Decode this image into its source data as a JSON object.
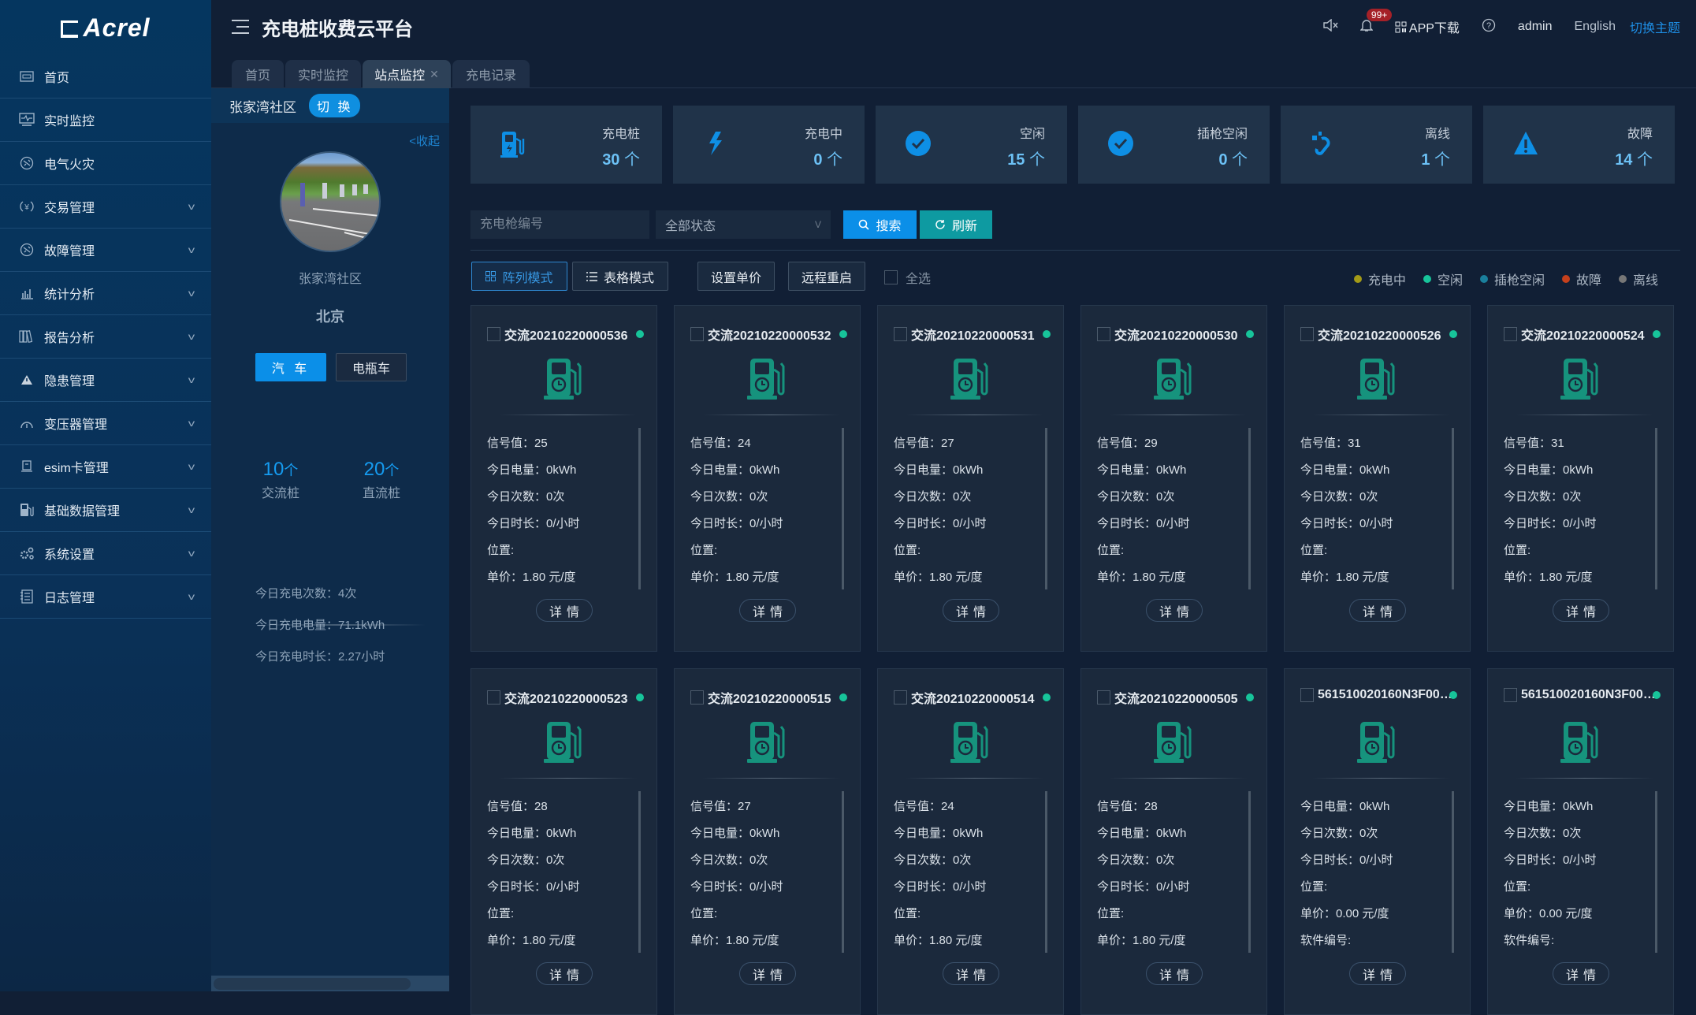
{
  "app": {
    "logo": "Acrel",
    "title": "充电桩收费云平台"
  },
  "topbar": {
    "mute_icon": "speaker-mute-icon",
    "notif_badge": "99+",
    "app_download": "APP下载",
    "help_icon": "question-circle-icon",
    "user": "admin",
    "language": "English",
    "theme_switch": "切换主题"
  },
  "sidebar": {
    "items": [
      {
        "label": "首页",
        "icon": "home-icon",
        "expandable": false
      },
      {
        "label": "实时监控",
        "icon": "monitor-icon",
        "expandable": false
      },
      {
        "label": "电气火灾",
        "icon": "fire-icon",
        "expandable": false
      },
      {
        "label": "交易管理",
        "icon": "transaction-icon",
        "expandable": true
      },
      {
        "label": "故障管理",
        "icon": "fault-icon",
        "expandable": true
      },
      {
        "label": "统计分析",
        "icon": "bar-chart-icon",
        "expandable": true
      },
      {
        "label": "报告分析",
        "icon": "report-icon",
        "expandable": true
      },
      {
        "label": "隐患管理",
        "icon": "warning-icon",
        "expandable": true
      },
      {
        "label": "变压器管理",
        "icon": "gauge-icon",
        "expandable": true
      },
      {
        "label": "esim卡管理",
        "icon": "sim-card-icon",
        "expandable": true
      },
      {
        "label": "基础数据管理",
        "icon": "charger-icon",
        "expandable": true
      },
      {
        "label": "系统设置",
        "icon": "gears-icon",
        "expandable": true
      },
      {
        "label": "日志管理",
        "icon": "log-icon",
        "expandable": true
      }
    ]
  },
  "tabs": [
    {
      "label": "首页",
      "active": false
    },
    {
      "label": "实时监控",
      "active": false
    },
    {
      "label": "站点监控",
      "active": true,
      "closable": true
    },
    {
      "label": "充电记录",
      "active": false
    }
  ],
  "station": {
    "header_name": "张家湾社区",
    "switch_label": "切 换",
    "collapse_label": "收起",
    "name": "张家湾社区",
    "city": "北京",
    "vehicle_types": [
      "汽 车",
      "电瓶车"
    ],
    "selected_vehicle": "汽 车",
    "ac_count": "10",
    "ac_label": "交流桩",
    "dc_count": "20",
    "dc_label": "直流桩",
    "count_unit": "个",
    "today": [
      {
        "label": "今日充电次数：",
        "value": "4次"
      },
      {
        "label": "今日充电电量：",
        "value": "71.1kWh"
      },
      {
        "label": "今日充电时长：",
        "value": "2.27小时"
      }
    ]
  },
  "stats": [
    {
      "label": "充电桩",
      "value": "30",
      "unit": "个",
      "icon": "charger-icon"
    },
    {
      "label": "充电中",
      "value": "0",
      "unit": "个",
      "icon": "lightning-icon"
    },
    {
      "label": "空闲",
      "value": "15",
      "unit": "个",
      "icon": "check-circle-icon"
    },
    {
      "label": "插枪空闲",
      "value": "0",
      "unit": "个",
      "icon": "check-circle-icon"
    },
    {
      "label": "离线",
      "value": "1",
      "unit": "个",
      "icon": "unplugged-icon"
    },
    {
      "label": "故障",
      "value": "14",
      "unit": "个",
      "icon": "alert-triangle-icon"
    }
  ],
  "filters": {
    "gun_placeholder": "充电枪编号",
    "gun_value": "",
    "status_selected": "全部状态",
    "search_label": "搜索",
    "refresh_label": "刷新"
  },
  "toolbar": {
    "grid_mode": "阵列模式",
    "table_mode": "表格模式",
    "set_price": "设置单价",
    "remote_restart": "远程重启",
    "select_all": "全选"
  },
  "legend": [
    {
      "label": "充电中",
      "color": "#a39a17"
    },
    {
      "label": "空闲",
      "color": "#17c49a"
    },
    {
      "label": "插枪空闲",
      "color": "#1a7f9c"
    },
    {
      "label": "故障",
      "color": "#c5401c"
    },
    {
      "label": "离线",
      "color": "#777777"
    }
  ],
  "card_labels": {
    "signal": "信号值：",
    "energy": "今日电量：",
    "count": "今日次数：",
    "duration": "今日时长：",
    "location": "位置:",
    "price": "单价：",
    "software": "软件编号:",
    "detail": "详情"
  },
  "cards": [
    {
      "id": "交流20210220000536",
      "signal": "25",
      "energy": "0kWh",
      "count": "0次",
      "duration": "0/小时",
      "location": "",
      "price": "1.80 元/度",
      "status_color": "#17c49a"
    },
    {
      "id": "交流20210220000532",
      "signal": "24",
      "energy": "0kWh",
      "count": "0次",
      "duration": "0/小时",
      "location": "",
      "price": "1.80 元/度",
      "status_color": "#17c49a"
    },
    {
      "id": "交流20210220000531",
      "signal": "27",
      "energy": "0kWh",
      "count": "0次",
      "duration": "0/小时",
      "location": "",
      "price": "1.80 元/度",
      "status_color": "#17c49a"
    },
    {
      "id": "交流20210220000530",
      "signal": "29",
      "energy": "0kWh",
      "count": "0次",
      "duration": "0/小时",
      "location": "",
      "price": "1.80 元/度",
      "status_color": "#17c49a"
    },
    {
      "id": "交流20210220000526",
      "signal": "31",
      "energy": "0kWh",
      "count": "0次",
      "duration": "0/小时",
      "location": "",
      "price": "1.80 元/度",
      "status_color": "#17c49a"
    },
    {
      "id": "交流20210220000524",
      "signal": "31",
      "energy": "0kWh",
      "count": "0次",
      "duration": "0/小时",
      "location": "",
      "price": "1.80 元/度",
      "status_color": "#17c49a"
    },
    {
      "id": "交流20210220000523",
      "signal": "28",
      "energy": "0kWh",
      "count": "0次",
      "duration": "0/小时",
      "location": "",
      "price": "1.80 元/度",
      "status_color": "#17c49a"
    },
    {
      "id": "交流20210220000515",
      "signal": "27",
      "energy": "0kWh",
      "count": "0次",
      "duration": "0/小时",
      "location": "",
      "price": "1.80 元/度",
      "status_color": "#17c49a"
    },
    {
      "id": "交流20210220000514",
      "signal": "24",
      "energy": "0kWh",
      "count": "0次",
      "duration": "0/小时",
      "location": "",
      "price": "1.80 元/度",
      "status_color": "#17c49a"
    },
    {
      "id": "交流20210220000505",
      "signal": "28",
      "energy": "0kWh",
      "count": "0次",
      "duration": "0/小时",
      "location": "",
      "price": "1.80 元/度",
      "status_color": "#17c49a"
    },
    {
      "id": "561510020160N3F000...",
      "signal": null,
      "energy": "0kWh",
      "count": "0次",
      "duration": "0/小时",
      "location": "",
      "price": "0.00 元/度",
      "software": "",
      "status_color": "#17c49a"
    },
    {
      "id": "561510020160N3F000...",
      "signal": null,
      "energy": "0kWh",
      "count": "0次",
      "duration": "0/小时",
      "location": "",
      "price": "0.00 元/度",
      "software": "",
      "status_color": "#17c49a"
    }
  ]
}
